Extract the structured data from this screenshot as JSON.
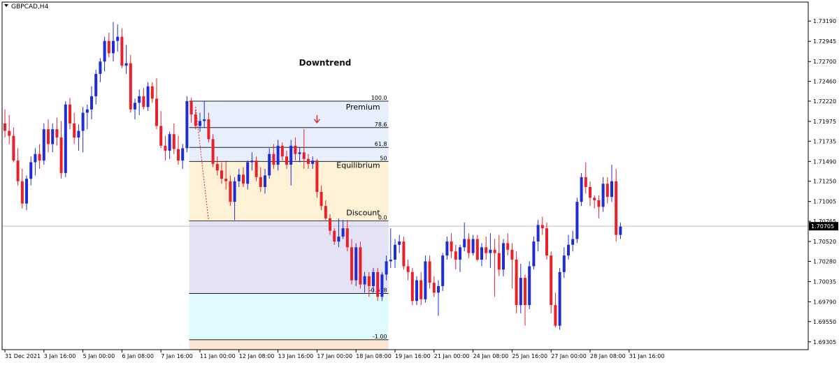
{
  "header": {
    "symbol_label": "GBPCAD,H4"
  },
  "colors": {
    "bull": "#1f2bd6",
    "bear": "#e8202a",
    "frame": "#000000",
    "grid_price_line": "#bfbfbf",
    "zone_premium": "#e6effb",
    "zone_equilibrium": "#fdf2d6",
    "zone_discount": "#e3e3f5",
    "zone_ext1": "#dffbfd",
    "zone_ext2": "#fbe6d3",
    "arrow": "#e8202a",
    "price_tag_bg": "#000000",
    "price_tag_text": "#ffffff"
  },
  "chart_data": {
    "type": "candlestick",
    "title": "Downtrend",
    "symbol": "GBPCAD",
    "timeframe": "H4",
    "current_price": 1.70705,
    "ylim": [
      1.6921,
      1.7342
    ],
    "y_ticks": [
      "1.73190",
      "1.72945",
      "1.72700",
      "1.72460",
      "1.72220",
      "1.71975",
      "1.71735",
      "1.71490",
      "1.71250",
      "1.71005",
      "1.70765",
      "1.70520",
      "1.70280",
      "1.70035",
      "1.69790",
      "1.69550",
      "1.69305"
    ],
    "x_ticks": [
      "31 Dec 2021",
      "3 Jan 16:00",
      "5 Jan 00:00",
      "6 Jan 08:00",
      "7 Jan 16:00",
      "11 Jan 00:00",
      "12 Jan 08:00",
      "13 Jan 16:00",
      "17 Jan 00:00",
      "18 Jan 08:00",
      "19 Jan 16:00",
      "21 Jan 00:00",
      "24 Jan 08:00",
      "25 Jan 16:00",
      "27 Jan 00:00",
      "28 Jan 08:00",
      "31 Jan 16:00"
    ],
    "x_tick_index": [
      0,
      9,
      18,
      27,
      36,
      45,
      54,
      63,
      72,
      81,
      90,
      99,
      108,
      117,
      126,
      135,
      144
    ],
    "fibonacci": {
      "high": 1.7222,
      "low": 1.7077,
      "start_index": 43,
      "end_index": 88,
      "levels": [
        {
          "label": "100.0",
          "price": 1.7222
        },
        {
          "label": "78.6",
          "price": 1.719
        },
        {
          "label": "61.8",
          "price": 1.7166
        },
        {
          "label": "50",
          "price": 1.7149
        },
        {
          "label": "0.0",
          "price": 1.7077
        },
        {
          "label": "-0.618",
          "price": 1.6989
        },
        {
          "label": "-1.00",
          "price": 1.6933
        }
      ],
      "zone_labels": [
        "Premium",
        "Equilibrium",
        "Discount"
      ]
    },
    "candles": [
      [
        1.7195,
        1.7212,
        1.7178,
        1.7186
      ],
      [
        1.7186,
        1.7205,
        1.717,
        1.718
      ],
      [
        1.718,
        1.719,
        1.7148,
        1.715
      ],
      [
        1.715,
        1.7165,
        1.712,
        1.7125
      ],
      [
        1.7125,
        1.714,
        1.7092,
        1.7098
      ],
      [
        1.7098,
        1.7132,
        1.709,
        1.7128
      ],
      [
        1.7128,
        1.7155,
        1.712,
        1.7148
      ],
      [
        1.7148,
        1.7165,
        1.7132,
        1.7158
      ],
      [
        1.7158,
        1.717,
        1.714,
        1.715
      ],
      [
        1.715,
        1.7195,
        1.7145,
        1.7188
      ],
      [
        1.7188,
        1.72,
        1.716,
        1.717
      ],
      [
        1.717,
        1.7195,
        1.716,
        1.7188
      ],
      [
        1.7188,
        1.7202,
        1.7168,
        1.7178
      ],
      [
        1.7178,
        1.7198,
        1.7128,
        1.7135
      ],
      [
        1.7135,
        1.7222,
        1.713,
        1.7218
      ],
      [
        1.7218,
        1.7226,
        1.7188,
        1.7195
      ],
      [
        1.7195,
        1.7208,
        1.717,
        1.7178
      ],
      [
        1.7178,
        1.7194,
        1.7162,
        1.7186
      ],
      [
        1.7186,
        1.7215,
        1.716,
        1.7208
      ],
      [
        1.7208,
        1.7218,
        1.7188,
        1.7212
      ],
      [
        1.7212,
        1.724,
        1.72,
        1.7228
      ],
      [
        1.7228,
        1.726,
        1.7218,
        1.7255
      ],
      [
        1.7255,
        1.7274,
        1.7245,
        1.727
      ],
      [
        1.727,
        1.73,
        1.7258,
        1.7295
      ],
      [
        1.7295,
        1.7305,
        1.7275,
        1.728
      ],
      [
        1.728,
        1.7318,
        1.727,
        1.7295
      ],
      [
        1.7295,
        1.7315,
        1.7282,
        1.73
      ],
      [
        1.73,
        1.731,
        1.7262,
        1.7265
      ],
      [
        1.7265,
        1.729,
        1.7255,
        1.7268
      ],
      [
        1.7268,
        1.7278,
        1.7208,
        1.7212
      ],
      [
        1.7212,
        1.7225,
        1.72,
        1.722
      ],
      [
        1.722,
        1.7236,
        1.7205,
        1.7228
      ],
      [
        1.7228,
        1.7238,
        1.7212,
        1.7215
      ],
      [
        1.7215,
        1.7245,
        1.721,
        1.724
      ],
      [
        1.724,
        1.7245,
        1.722,
        1.7225
      ],
      [
        1.7225,
        1.725,
        1.7188,
        1.7192
      ],
      [
        1.7192,
        1.721,
        1.7165,
        1.7168
      ],
      [
        1.7168,
        1.718,
        1.715,
        1.7162
      ],
      [
        1.7162,
        1.7185,
        1.7152,
        1.7182
      ],
      [
        1.7182,
        1.7195,
        1.7158,
        1.7164
      ],
      [
        1.7164,
        1.718,
        1.7145,
        1.715
      ],
      [
        1.715,
        1.717,
        1.714,
        1.7165
      ],
      [
        1.7165,
        1.7228,
        1.716,
        1.7222
      ],
      [
        1.7222,
        1.7226,
        1.7196,
        1.7206
      ],
      [
        1.7206,
        1.7212,
        1.7188,
        1.7192
      ],
      [
        1.7192,
        1.7208,
        1.7185,
        1.7198
      ],
      [
        1.7198,
        1.7222,
        1.719,
        1.72
      ],
      [
        1.72,
        1.7208,
        1.7172,
        1.7176
      ],
      [
        1.7176,
        1.7182,
        1.7142,
        1.7146
      ],
      [
        1.7146,
        1.7155,
        1.7132,
        1.7138
      ],
      [
        1.7138,
        1.7148,
        1.7122,
        1.7128
      ],
      [
        1.7128,
        1.715,
        1.7115,
        1.7125
      ],
      [
        1.7125,
        1.7132,
        1.7095,
        1.71
      ],
      [
        1.71,
        1.713,
        1.7078,
        1.7125
      ],
      [
        1.7125,
        1.714,
        1.7118,
        1.7133
      ],
      [
        1.7133,
        1.7142,
        1.7118,
        1.7122
      ],
      [
        1.7122,
        1.715,
        1.7115,
        1.7148
      ],
      [
        1.7148,
        1.716,
        1.7138,
        1.715
      ],
      [
        1.715,
        1.7155,
        1.7125,
        1.713
      ],
      [
        1.713,
        1.7142,
        1.7112,
        1.7118
      ],
      [
        1.7118,
        1.714,
        1.711,
        1.7132
      ],
      [
        1.7132,
        1.7165,
        1.7128,
        1.7158
      ],
      [
        1.7158,
        1.717,
        1.714,
        1.7145
      ],
      [
        1.7145,
        1.7175,
        1.7138,
        1.7168
      ],
      [
        1.7168,
        1.7172,
        1.715,
        1.7155
      ],
      [
        1.7155,
        1.7162,
        1.714,
        1.7145
      ],
      [
        1.7145,
        1.7175,
        1.712,
        1.7168
      ],
      [
        1.7168,
        1.7178,
        1.715,
        1.7158
      ],
      [
        1.7158,
        1.7166,
        1.7148,
        1.716
      ],
      [
        1.716,
        1.7188,
        1.714,
        1.7152
      ],
      [
        1.7152,
        1.7158,
        1.714,
        1.7146
      ],
      [
        1.7146,
        1.7155,
        1.714,
        1.715
      ],
      [
        1.715,
        1.7152,
        1.7105,
        1.7112
      ],
      [
        1.7112,
        1.712,
        1.709,
        1.7095
      ],
      [
        1.7095,
        1.7102,
        1.7078,
        1.708
      ],
      [
        1.708,
        1.7085,
        1.706,
        1.7065
      ],
      [
        1.7065,
        1.7068,
        1.7048,
        1.7052
      ],
      [
        1.7052,
        1.708,
        1.7045,
        1.7058
      ],
      [
        1.7058,
        1.7078,
        1.7055,
        1.7068
      ],
      [
        1.7068,
        1.7078,
        1.704,
        1.7045
      ],
      [
        1.7045,
        1.7055,
        1.7,
        1.7005
      ],
      [
        1.7005,
        1.705,
        1.6998,
        1.7045
      ],
      [
        1.7045,
        1.7052,
        1.6995,
        1.7
      ],
      [
        1.7,
        1.7015,
        1.699,
        1.701
      ],
      [
        1.701,
        1.7015,
        1.6985,
        1.6998
      ],
      [
        1.6998,
        1.702,
        1.699,
        1.7015
      ],
      [
        1.7015,
        1.702,
        1.698,
        1.6985
      ],
      [
        1.6985,
        1.7015,
        1.698,
        1.7012
      ],
      [
        1.7012,
        1.7035,
        1.7005,
        1.7028
      ],
      [
        1.7028,
        1.7068,
        1.702,
        1.703
      ],
      [
        1.703,
        1.7055,
        1.702,
        1.7048
      ],
      [
        1.7048,
        1.706,
        1.7038,
        1.7052
      ],
      [
        1.7052,
        1.7058,
        1.7018,
        1.7022
      ],
      [
        1.7022,
        1.703,
        1.7005,
        1.7015
      ],
      [
        1.7015,
        1.702,
        1.6975,
        1.698
      ],
      [
        1.698,
        1.701,
        1.6975,
        1.7005
      ],
      [
        1.7005,
        1.7015,
        1.6975,
        1.6982
      ],
      [
        1.6982,
        1.7035,
        1.6978,
        1.7028
      ],
      [
        1.7028,
        1.7035,
        1.6995,
        1.7002
      ],
      [
        1.7002,
        1.701,
        1.6985,
        1.699
      ],
      [
        1.699,
        1.7005,
        1.6962,
        1.6998
      ],
      [
        1.6998,
        1.7038,
        1.6992,
        1.7035
      ],
      [
        1.7035,
        1.7058,
        1.703,
        1.7052
      ],
      [
        1.7052,
        1.7062,
        1.7032,
        1.704
      ],
      [
        1.704,
        1.7048,
        1.7018,
        1.703
      ],
      [
        1.703,
        1.7048,
        1.7015,
        1.7045
      ],
      [
        1.7045,
        1.7075,
        1.704,
        1.7055
      ],
      [
        1.7055,
        1.7062,
        1.7032,
        1.7038
      ],
      [
        1.7038,
        1.706,
        1.7035,
        1.7055
      ],
      [
        1.7055,
        1.706,
        1.7028,
        1.703
      ],
      [
        1.703,
        1.705,
        1.7022,
        1.7045
      ],
      [
        1.7045,
        1.7058,
        1.703,
        1.7038
      ],
      [
        1.7038,
        1.7062,
        1.702,
        1.7042
      ],
      [
        1.7042,
        1.7055,
        1.6985,
        1.7038
      ],
      [
        1.7038,
        1.706,
        1.701,
        1.7018
      ],
      [
        1.7018,
        1.7055,
        1.701,
        1.705
      ],
      [
        1.705,
        1.7062,
        1.7035,
        1.7042
      ],
      [
        1.7042,
        1.705,
        1.6995,
        1.703
      ],
      [
        1.703,
        1.704,
        1.6965,
        1.6975
      ],
      [
        1.6975,
        1.7025,
        1.6965,
        1.7008
      ],
      [
        1.7008,
        1.7012,
        1.695,
        1.6975
      ],
      [
        1.6975,
        1.7028,
        1.697,
        1.7022
      ],
      [
        1.7022,
        1.7058,
        1.7018,
        1.7052
      ],
      [
        1.7052,
        1.7078,
        1.704,
        1.7072
      ],
      [
        1.7072,
        1.7082,
        1.706,
        1.7068
      ],
      [
        1.7068,
        1.7075,
        1.703,
        1.7035
      ],
      [
        1.7035,
        1.704,
        1.6965,
        1.6975
      ],
      [
        1.6975,
        1.699,
        1.6948,
        1.695
      ],
      [
        1.695,
        1.702,
        1.6945,
        1.7015
      ],
      [
        1.7015,
        1.7045,
        1.7008,
        1.7035
      ],
      [
        1.7035,
        1.706,
        1.703,
        1.7048
      ],
      [
        1.7048,
        1.7065,
        1.704,
        1.7055
      ],
      [
        1.7055,
        1.7105,
        1.705,
        1.71
      ],
      [
        1.71,
        1.7135,
        1.7095,
        1.713
      ],
      [
        1.713,
        1.7148,
        1.711,
        1.7118
      ],
      [
        1.7118,
        1.7125,
        1.7095,
        1.7105
      ],
      [
        1.7105,
        1.7108,
        1.7092,
        1.7102
      ],
      [
        1.7102,
        1.7108,
        1.708,
        1.7094
      ],
      [
        1.7094,
        1.713,
        1.7088,
        1.7122
      ],
      [
        1.7122,
        1.713,
        1.7098,
        1.7106
      ],
      [
        1.7106,
        1.7145,
        1.71,
        1.7125
      ],
      [
        1.7125,
        1.714,
        1.7052,
        1.706
      ],
      [
        1.706,
        1.7075,
        1.7055,
        1.707
      ]
    ]
  }
}
